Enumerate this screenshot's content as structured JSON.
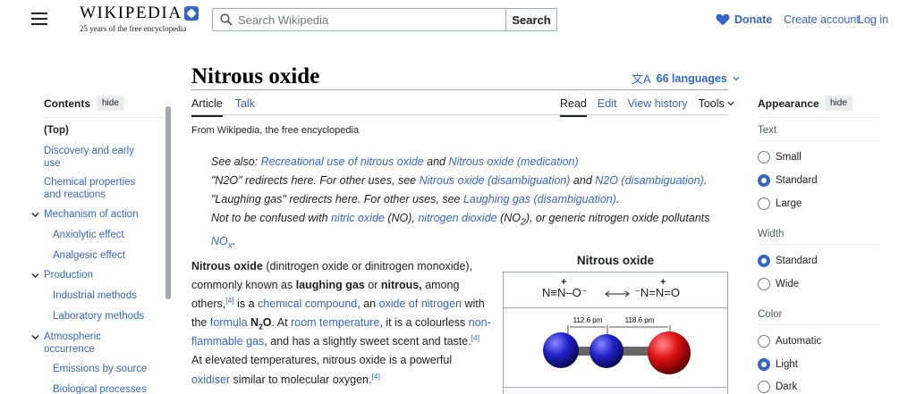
{
  "header": {
    "logo_text": "WIKIPEDIA",
    "tagline": "25 years of the free encyclopedia",
    "search_placeholder": "Search Wikipedia",
    "search_button": "Search",
    "donate": "Donate",
    "create_account": "Create account",
    "login": "Log in"
  },
  "article": {
    "title": "Nitrous oxide",
    "languages": "66 languages",
    "tabs_left": [
      "Article",
      "Talk"
    ],
    "tabs_right": [
      "Read",
      "Edit",
      "View history",
      "Tools"
    ],
    "from_wiki": "From Wikipedia, the free encyclopedia",
    "hatnote1_pre": "See also: ",
    "hatnote1_link1": "Recreational use of nitrous oxide",
    "hatnote1_mid": " and ",
    "hatnote1_link2": "Nitrous oxide (medication)",
    "hatnote2_pre": "\"N2O\" redirects here. For other uses, see ",
    "hatnote2_link1": "Nitrous oxide (disambiguation)",
    "hatnote2_mid": " and ",
    "hatnote2_link2": "N2O (disambiguation)",
    "hatnote2_end": ".",
    "hatnote3_pre": "\"Laughing gas\" redirects here. For other uses, see ",
    "hatnote3_link": "Laughing gas (disambiguation)",
    "hatnote3_end": ".",
    "hatnote4_pre": "Not to be confused with ",
    "hatnote4_link1": "nitric oxide",
    "hatnote4_t1": " (NO), ",
    "hatnote4_link2": "nitrogen dioxide",
    "hatnote4_t2": " (NO",
    "hatnote4_sub": "2",
    "hatnote4_t3": "), or generic nitrogen oxide pollutants ",
    "hatnote4_link3": "NO",
    "hatnote4_sub2": "x",
    "hatnote4_end": ".",
    "body": {
      "b1": "Nitrous oxide",
      "t1": " (dinitrogen oxide or dinitrogen monoxide), commonly known as ",
      "b2": "laughing gas",
      "t2": " or ",
      "b3": "nitrous,",
      "t3": " among others,",
      "ref1": "[4]",
      "t4": " is a ",
      "l1": "chemical compound",
      "t5": ", an ",
      "l2": "oxide of nitrogen",
      "t6": " with the ",
      "l3": "formula",
      "t7": " ",
      "b4": "N",
      "b4sub": "2",
      "b4b": "O",
      "t8": ". At ",
      "l4": "room temperature",
      "t9": ", it is a colourless ",
      "l5": "non-flammable gas",
      "t10": ", and has a slightly sweet scent and taste.",
      "ref2": "[4]",
      "t11": " At elevated temperatures, nitrous oxide is a powerful ",
      "l6": "oxidiser",
      "t12": " similar to molecular oxygen.",
      "ref3": "[4]"
    },
    "infobox": {
      "title": "Nitrous oxide",
      "res1": "N≡N–O⁻",
      "res2": "⁻N=N=O",
      "plus": "+",
      "bond1": "112.6 pm",
      "bond2": "118.6 pm"
    }
  },
  "toc": {
    "heading": "Contents",
    "hide": "hide",
    "items": [
      {
        "label": "(Top)"
      },
      {
        "label": "Discovery and early use"
      },
      {
        "label": "Chemical properties and reactions"
      },
      {
        "label": "Mechanism of action"
      },
      {
        "label": "Anxiolytic effect"
      },
      {
        "label": "Analgesic effect"
      },
      {
        "label": "Production"
      },
      {
        "label": "Industrial methods"
      },
      {
        "label": "Laboratory methods"
      },
      {
        "label": "Atmospheric occurrence"
      },
      {
        "label": "Emissions by source"
      },
      {
        "label": "Biological processes"
      }
    ]
  },
  "appearance": {
    "heading": "Appearance",
    "hide": "hide",
    "text_label": "Text",
    "text_options": [
      "Small",
      "Standard",
      "Large"
    ],
    "text_selected": "Standard",
    "width_label": "Width",
    "width_options": [
      "Standard",
      "Wide"
    ],
    "width_selected": "Standard",
    "color_label": "Color",
    "color_options": [
      "Automatic",
      "Light",
      "Dark"
    ],
    "color_selected": "Light"
  },
  "colors": {
    "link": "#3366cc",
    "nitrogen_atom": "#2222cc",
    "oxygen_atom": "#dd1111"
  }
}
